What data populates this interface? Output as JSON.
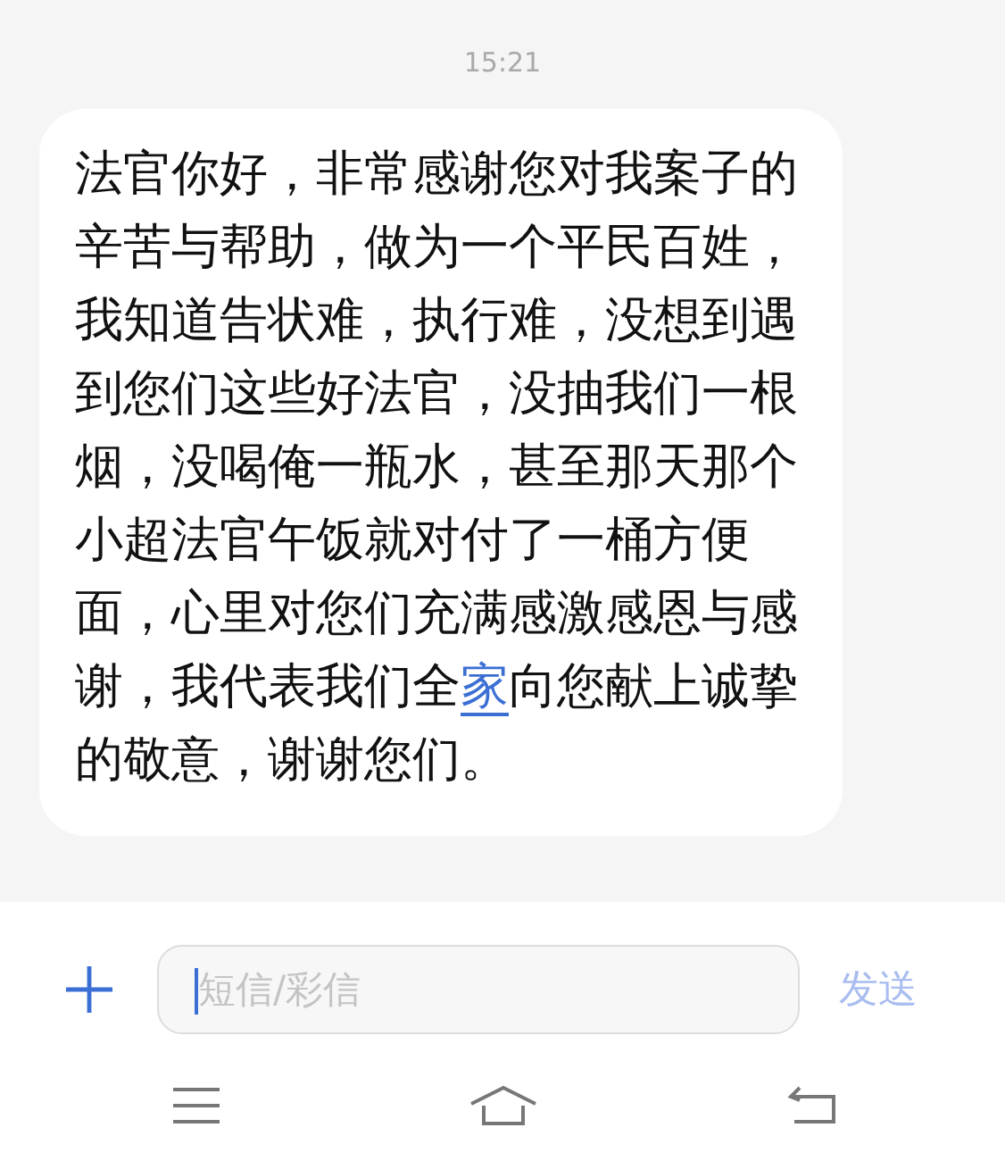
{
  "timestamp": "15:21",
  "message": {
    "parts": [
      {
        "kind": "text",
        "text": "法官你好，非常感谢您对我案子的辛苦与帮助，做为一个平民百姓，我知道告状难，执行难，没想到遇到您们这些好法官，没抽我们一根烟，没喝俺一瓶水，甚至那天那个小超法官午饭就对付了一桶方便面，心里对您们充满感激感恩与感谢，我代表我们全"
      },
      {
        "kind": "link",
        "text": "家"
      },
      {
        "kind": "text",
        "text": "向您献上诚挚的敬意，谢谢您们。"
      }
    ]
  },
  "composer": {
    "placeholder": "短信/彩信",
    "send": {
      "label": "发送",
      "disabled": true
    }
  }
}
